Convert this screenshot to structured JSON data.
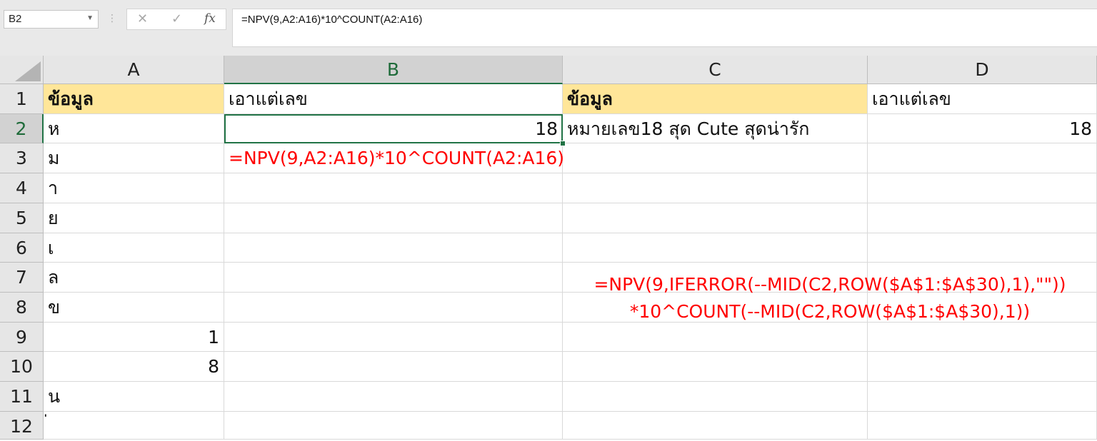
{
  "formula_bar": {
    "name_box": "B2",
    "cancel_icon": "✕",
    "enter_icon": "✓",
    "fx_label": "fx",
    "formula": "=NPV(9,A2:A16)*10^COUNT(A2:A16)"
  },
  "columns": [
    "A",
    "B",
    "C",
    "D"
  ],
  "rows": [
    "1",
    "2",
    "3",
    "4",
    "5",
    "6",
    "7",
    "8",
    "9",
    "10",
    "11",
    "12"
  ],
  "cells": {
    "A1": "ข้อมูล",
    "B1": "เอาแต่เลข",
    "C1": "ข้อมูล",
    "D1": "เอาแต่เลข",
    "A2": "ห",
    "B2": "18",
    "C2": "หมายเลข18 สุด Cute สุดน่ารัก",
    "D2": "18",
    "A3": "ม",
    "B3": "=NPV(9,A2:A16)*10^COUNT(A2:A16)",
    "A4": "า",
    "A5": "ย",
    "A6": "เ",
    "A7": "ล",
    "A8": "ข",
    "A9": "1",
    "A10": "8",
    "A11": "น",
    "A12": "่"
  },
  "annotation": {
    "line1": "=NPV(9,IFERROR(--MID(C2,ROW($A$1:$A$30),1),\"\"))",
    "line2": "*10^COUNT(--MID(C2,ROW($A$1:$A$30),1))"
  },
  "colors": {
    "header_fill": "#ffe699",
    "selection": "#217346",
    "annotation": "#ff0000"
  }
}
